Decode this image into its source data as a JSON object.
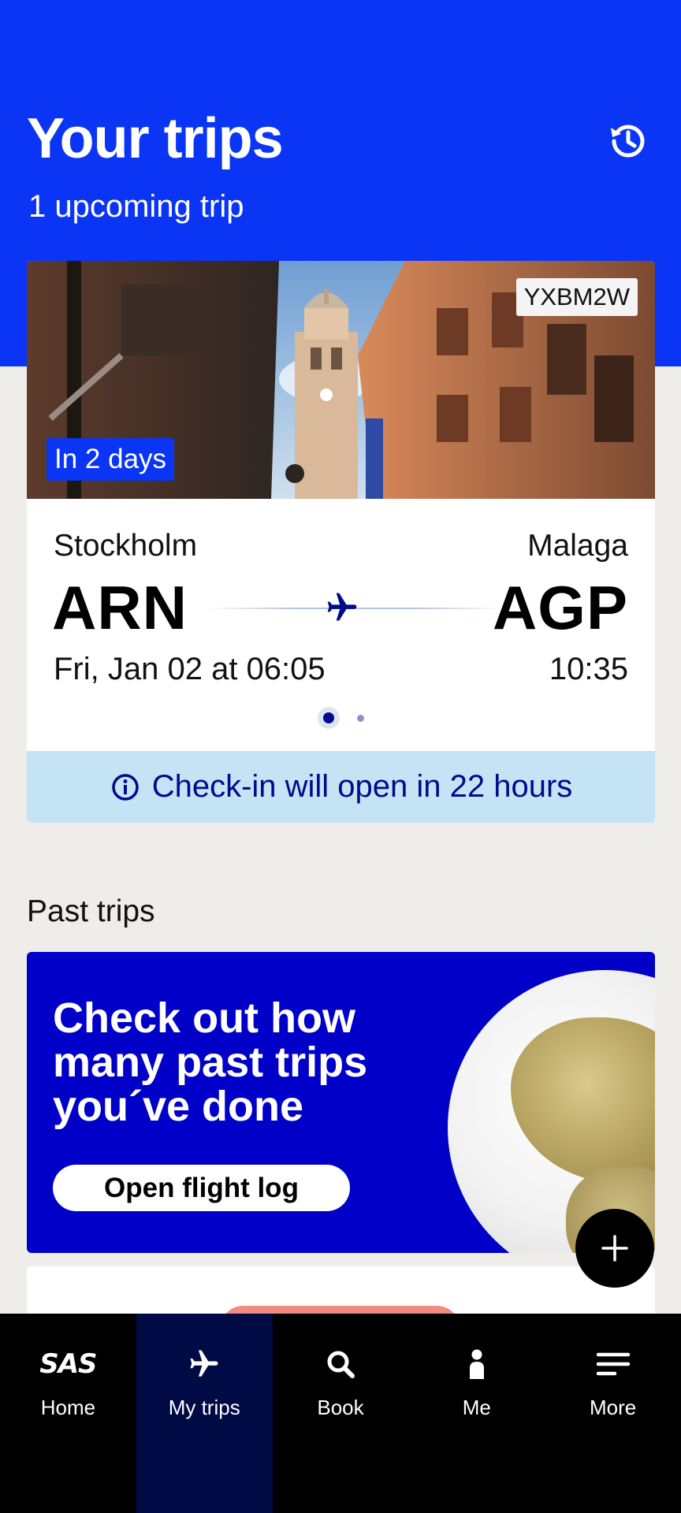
{
  "header": {
    "title": "Your trips",
    "subtitle": "1 upcoming trip"
  },
  "trip": {
    "booking_ref": "YXBM2W",
    "countdown": "In 2 days",
    "from_city": "Stockholm",
    "from_code": "ARN",
    "to_city": "Malaga",
    "to_code": "AGP",
    "depart": "Fri, Jan 02 at 06:05",
    "arrive": "10:35",
    "checkin_notice": "Check-in will open in 22 hours"
  },
  "past_trips": {
    "section_title": "Past trips",
    "promo_title": "Check out how many past trips you´ve done",
    "button_label": "Open flight log"
  },
  "nav": {
    "items": [
      {
        "label": "Home",
        "icon": "sas-logo-icon"
      },
      {
        "label": "My trips",
        "icon": "plane-icon",
        "active": true
      },
      {
        "label": "Book",
        "icon": "search-icon"
      },
      {
        "label": "Me",
        "icon": "person-icon"
      },
      {
        "label": "More",
        "icon": "menu-icon"
      }
    ],
    "logo_text": "SAS"
  },
  "colors": {
    "brand_blue": "#0a35f5",
    "promo_blue": "#0000c8",
    "nav_active": "#000a45",
    "checkin_bg": "#c4e3f4",
    "checkin_text": "#000a8c"
  }
}
